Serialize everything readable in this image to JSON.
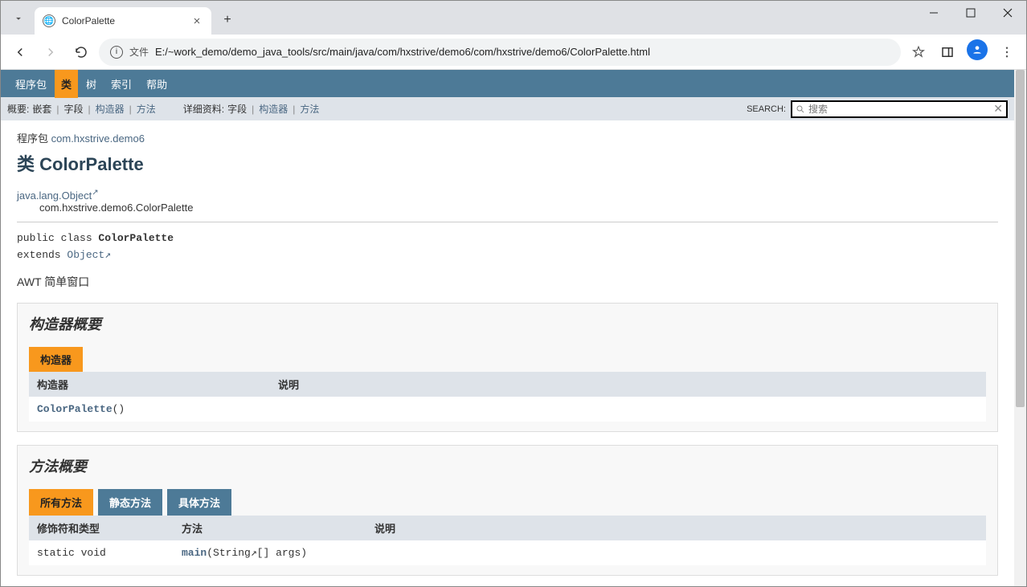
{
  "browser": {
    "tab_title": "ColorPalette",
    "url_prefix": "文件",
    "url": "E:/~work_demo/demo_java_tools/src/main/java/com/hxstrive/demo6/com/hxstrive/demo6/ColorPalette.html"
  },
  "nav": {
    "items": [
      "程序包",
      "类",
      "树",
      "索引",
      "帮助"
    ],
    "active_index": 1
  },
  "subnav": {
    "summary_label": "概要:",
    "summary_items": [
      "嵌套",
      "字段",
      "构造器",
      "方法"
    ],
    "summary_link_indices": [
      2,
      3
    ],
    "detail_label": "详细资料:",
    "detail_items": [
      "字段",
      "构造器",
      "方法"
    ],
    "detail_link_indices": [
      1,
      2
    ],
    "search_label": "SEARCH:",
    "search_placeholder": "搜索"
  },
  "doc": {
    "pkg_label": "程序包",
    "pkg_link": "com.hxstrive.demo6",
    "class_title": "类 ColorPalette",
    "inherit_l1": "java.lang.Object",
    "inherit_l2": "com.hxstrive.demo6.ColorPalette",
    "sig_prefix": "public class ",
    "sig_class": "ColorPalette",
    "sig_extends": "extends ",
    "sig_object": "Object",
    "description": "AWT 简单窗口",
    "constructor_section_title": "构造器概要",
    "constructor_tab": "构造器",
    "constructor_col1": "构造器",
    "constructor_col2": "说明",
    "constructor_name": "ColorPalette",
    "constructor_paren": "()",
    "method_section_title": "方法概要",
    "method_tabs": [
      "所有方法",
      "静态方法",
      "具体方法"
    ],
    "method_col1": "修饰符和类型",
    "method_col2": "方法",
    "method_col3": "说明",
    "method_modifier": "static void",
    "method_name": "main",
    "method_paren_open": "(",
    "method_param_type": "String",
    "method_param_rest": "[]  args)",
    "ext_icon": "↗"
  }
}
